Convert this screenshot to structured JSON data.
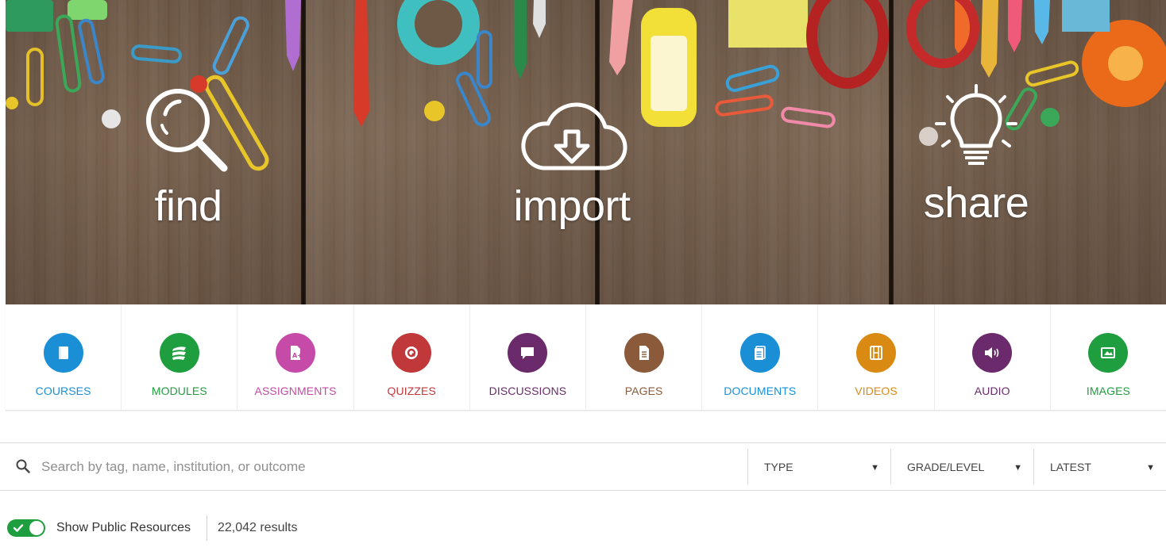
{
  "hero": {
    "find_label": "find",
    "import_label": "import",
    "share_label": "share"
  },
  "categories": [
    {
      "label": "COURSES",
      "icon": "book-icon",
      "color": "#1a8fd6"
    },
    {
      "label": "MODULES",
      "icon": "stack-icon",
      "color": "#1e9e3e"
    },
    {
      "label": "ASSIGNMENTS",
      "icon": "assignment-icon",
      "color": "#c64aa7"
    },
    {
      "label": "QUIZZES",
      "icon": "quiz-icon",
      "color": "#c0383a"
    },
    {
      "label": "DISCUSSIONS",
      "icon": "chat-icon",
      "color": "#6b2a6b"
    },
    {
      "label": "PAGES",
      "icon": "page-icon",
      "color": "#8a5a3a"
    },
    {
      "label": "DOCUMENTS",
      "icon": "document-icon",
      "color": "#1a8fd6"
    },
    {
      "label": "VIDEOS",
      "icon": "film-icon",
      "color": "#d98a12"
    },
    {
      "label": "AUDIO",
      "icon": "speaker-icon",
      "color": "#6b2a6b"
    },
    {
      "label": "IMAGES",
      "icon": "image-icon",
      "color": "#1e9e3e"
    }
  ],
  "search": {
    "placeholder": "Search by tag, name, institution, or outcome",
    "type_label": "TYPE",
    "grade_label": "GRADE/LEVEL",
    "sort_label": "LATEST",
    "caret": "▼"
  },
  "filters": {
    "show_public_label": "Show Public Resources",
    "show_public_on": true,
    "results_text": "22,042 results"
  }
}
